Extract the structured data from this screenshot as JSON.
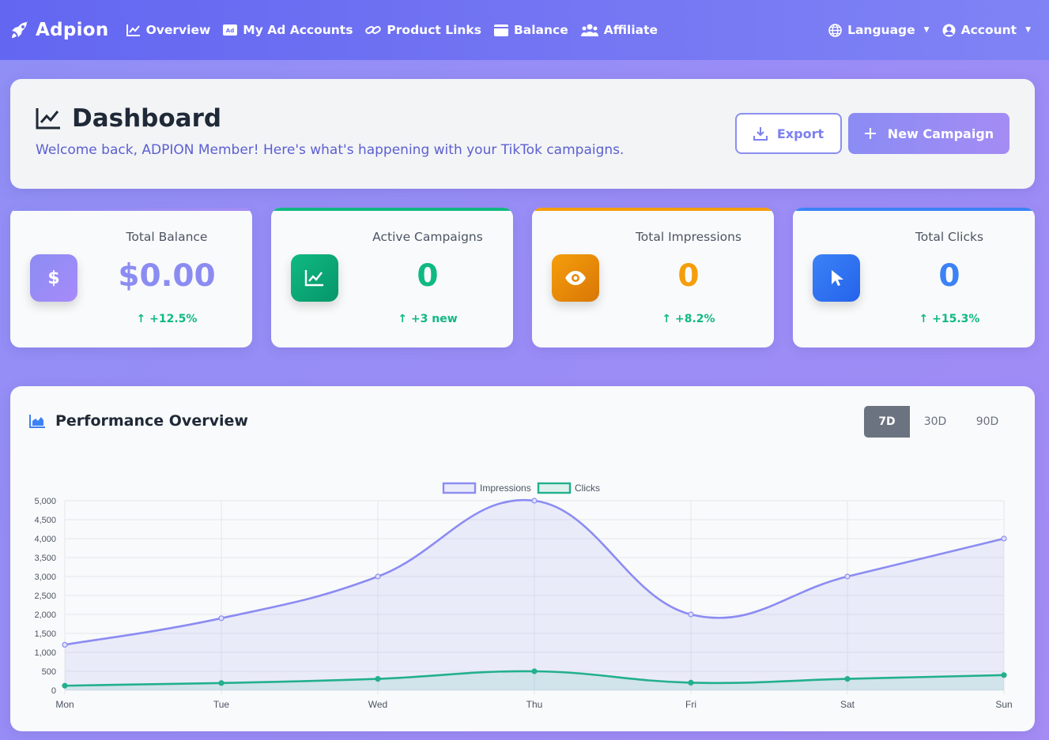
{
  "nav": {
    "brand": "Adpion",
    "links": [
      "Overview",
      "My Ad Accounts",
      "Product Links",
      "Balance",
      "Affiliate"
    ],
    "language": "Language",
    "account": "Account",
    "icons": [
      "chart-line-icon",
      "ad-icon",
      "link-icon",
      "wallet-icon",
      "users-icon"
    ]
  },
  "header": {
    "title": "Dashboard",
    "subtitle": "Welcome back, ADPION Member! Here's what's happening with your TikTok campaigns.",
    "export_label": "Export",
    "new_campaign_label": "New Campaign"
  },
  "stats": [
    {
      "label": "Total Balance",
      "value": "$0.00",
      "change": "+12.5%",
      "color": "#8b8cf2",
      "icon": "dollar-icon"
    },
    {
      "label": "Active Campaigns",
      "value": "0",
      "change": "+3 new",
      "color": "#10b981",
      "icon": "chart-line-icon"
    },
    {
      "label": "Total Impressions",
      "value": "0",
      "change": "+8.2%",
      "color": "#f59e0b",
      "icon": "eye-icon"
    },
    {
      "label": "Total Clicks",
      "value": "0",
      "change": "+15.3%",
      "color": "#3b82f6",
      "icon": "cursor-icon"
    }
  ],
  "performance": {
    "title": "Performance Overview",
    "ranges": [
      "7D",
      "30D",
      "90D"
    ],
    "active_range": "7D"
  },
  "chart_data": {
    "type": "line",
    "categories": [
      "Mon",
      "Tue",
      "Wed",
      "Thu",
      "Fri",
      "Sat",
      "Sun"
    ],
    "series": [
      {
        "name": "Impressions",
        "values": [
          1200,
          1900,
          3000,
          5000,
          2000,
          3000,
          4000
        ],
        "color": "#8b8cf2"
      },
      {
        "name": "Clicks",
        "values": [
          120,
          190,
          300,
          500,
          200,
          300,
          400
        ],
        "color": "#22b08d"
      }
    ],
    "yticks": [
      "0",
      "500",
      "1,000",
      "1,500",
      "2,000",
      "2,500",
      "3,000",
      "3,500",
      "4,000",
      "4,500",
      "5,000"
    ],
    "ylim": [
      0,
      5000
    ],
    "grid": true,
    "legend": "top-center"
  }
}
